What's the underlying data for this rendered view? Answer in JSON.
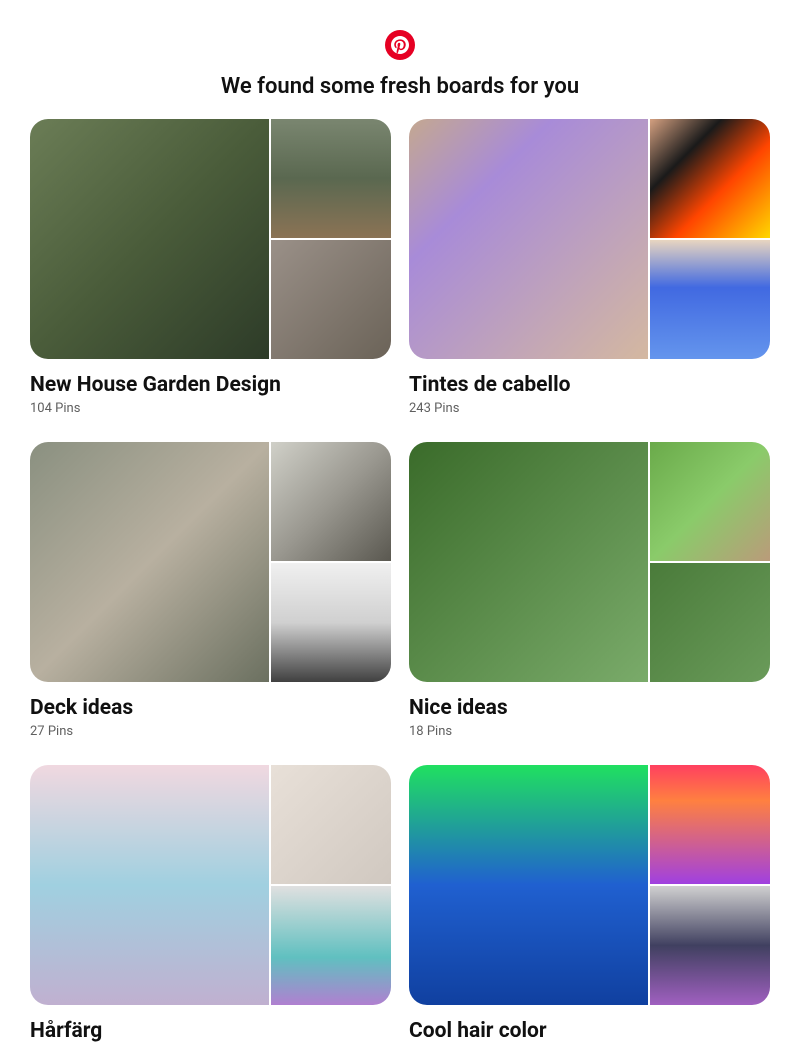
{
  "brand_color": "#e60023",
  "headline": "We found some fresh boards for you",
  "boards": [
    {
      "title": "New House Garden Design",
      "pin_count": 104,
      "pin_label": "Pins"
    },
    {
      "title": "Tintes de cabello",
      "pin_count": 243,
      "pin_label": "Pins"
    },
    {
      "title": "Deck ideas",
      "pin_count": 27,
      "pin_label": "Pins"
    },
    {
      "title": "Nice ideas",
      "pin_count": 18,
      "pin_label": "Pins"
    },
    {
      "title": "Hårfärg",
      "pin_count": null,
      "pin_label": ""
    },
    {
      "title": "Cool hair color",
      "pin_count": null,
      "pin_label": ""
    }
  ]
}
